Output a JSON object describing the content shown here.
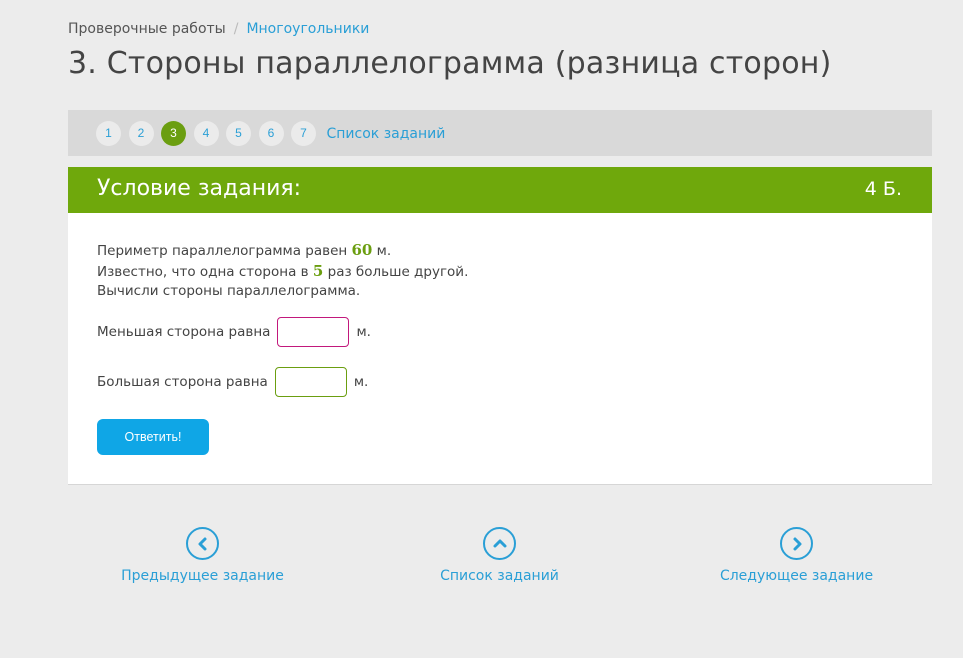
{
  "breadcrumb": {
    "root": "Проверочные работы",
    "separator": "/",
    "current": "Многоугольники"
  },
  "page_title": "3. Стороны параллелограмма (разница сторон)",
  "task_nav": {
    "numbers": [
      "1",
      "2",
      "3",
      "4",
      "5",
      "6",
      "7"
    ],
    "active": "3",
    "list_link": "Список заданий"
  },
  "card": {
    "header": "Условие задания:",
    "points": "4 Б.",
    "problem": {
      "line1_pre": "Периметр параллелограмма равен ",
      "line1_value": "60",
      "line1_post": " м.",
      "line2_pre": "Известно, что одна сторона в ",
      "line2_value": "5",
      "line2_post": " раз больше другой.",
      "line3": "Вычисли стороны параллелограмма."
    },
    "answers": [
      {
        "label": "Меньшая сторона равна",
        "value": "",
        "unit": "м."
      },
      {
        "label": "Большая сторона равна",
        "value": "",
        "unit": "м."
      }
    ],
    "submit_label": "Ответить!"
  },
  "bottom_nav": {
    "prev": {
      "label": "Предыдущее задание",
      "icon": "chevron-left-icon"
    },
    "list": {
      "label": "Список заданий",
      "icon": "chevron-up-icon"
    },
    "next": {
      "label": "Следующее задание",
      "icon": "chevron-right-icon"
    }
  },
  "colors": {
    "accent_green": "#6fa80c",
    "link_blue": "#2a9fd6",
    "button_blue": "#0fa6e6",
    "input_focus_magenta": "#c2187c"
  }
}
